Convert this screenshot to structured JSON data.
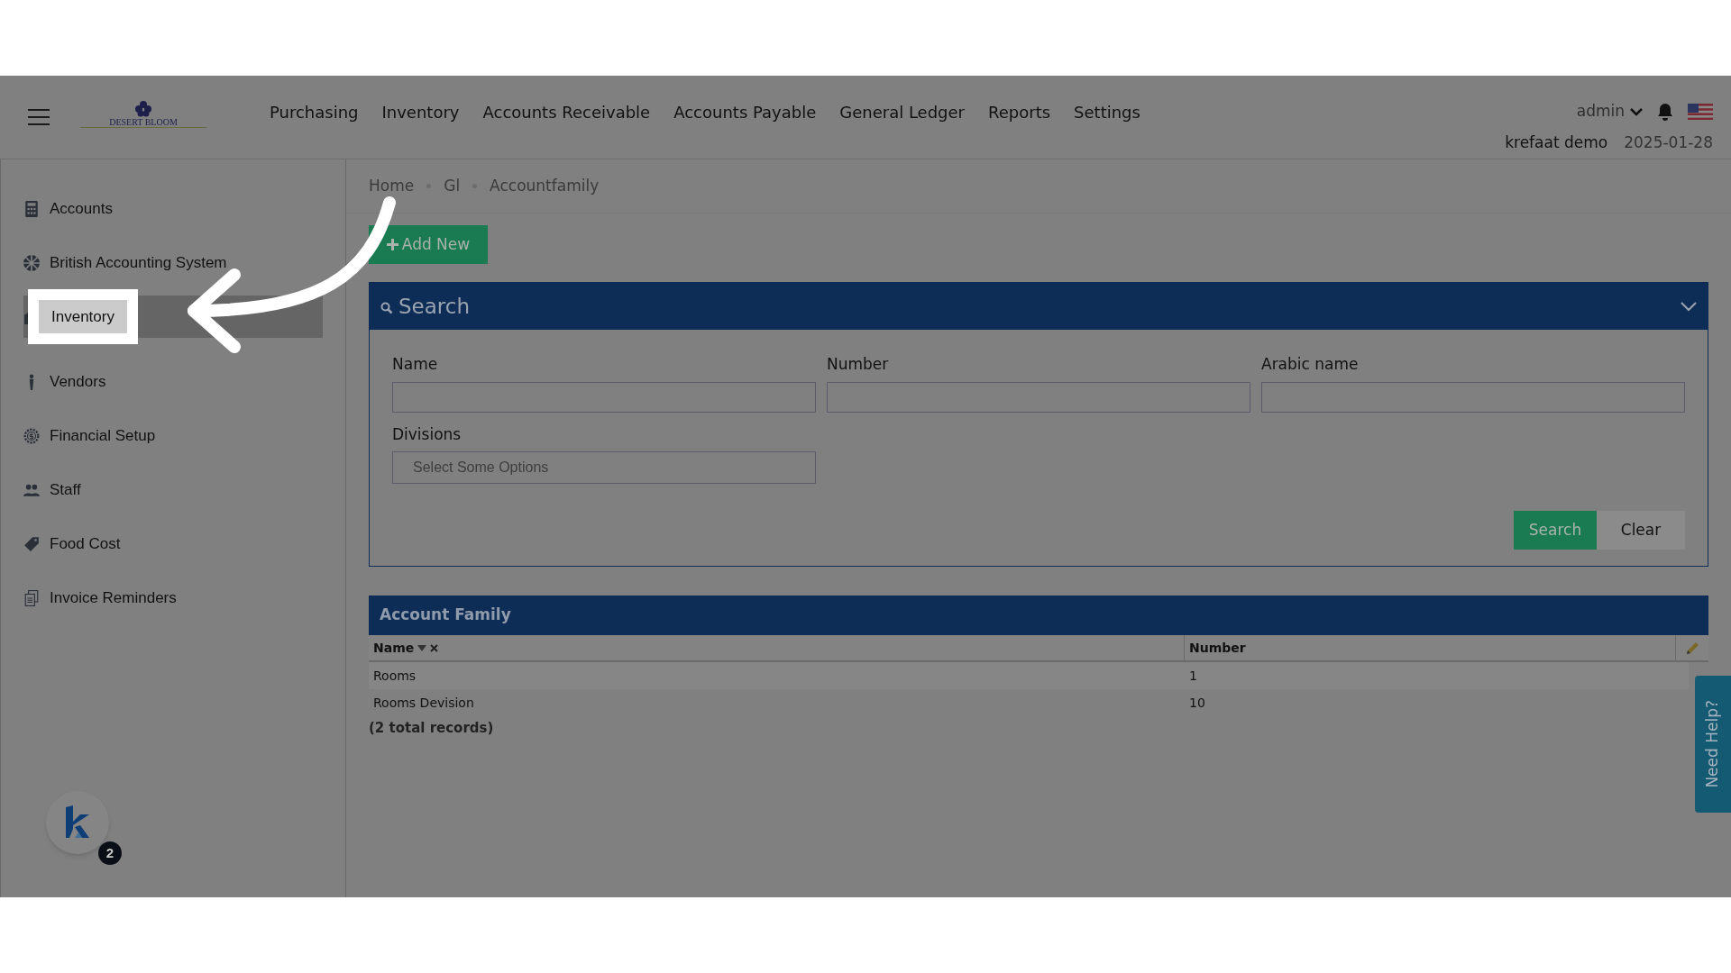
{
  "header": {
    "logo_text": "DESERT BLOOM",
    "menu": [
      "Purchasing",
      "Inventory",
      "Accounts Receivable",
      "Accounts Payable",
      "General Ledger",
      "Reports",
      "Settings"
    ],
    "user": "admin",
    "company": "krefaat demo",
    "date": "2025-01-28"
  },
  "sidebar": {
    "items": [
      {
        "label": "Accounts",
        "selected": false
      },
      {
        "label": "British Accounting System",
        "selected": false
      },
      {
        "label": "Inventory",
        "selected": true
      },
      {
        "label": "Vendors",
        "selected": false
      },
      {
        "label": "Financial Setup",
        "selected": false
      },
      {
        "label": "Staff",
        "selected": false
      },
      {
        "label": "Food Cost",
        "selected": false
      },
      {
        "label": "Invoice Reminders",
        "selected": false
      }
    ],
    "badge": "2"
  },
  "breadcrumb": [
    "Home",
    "Gl",
    "Accountfamily"
  ],
  "add_button": "Add New",
  "search_panel": {
    "title": "Search",
    "fields": [
      {
        "label": "Name",
        "kind": "text"
      },
      {
        "label": "Number",
        "kind": "text"
      },
      {
        "label": "Arabic name",
        "kind": "text"
      },
      {
        "label": "Divisions",
        "kind": "select",
        "placeholder": "Select Some Options"
      }
    ],
    "buttons": [
      "Search",
      "Clear"
    ]
  },
  "table": {
    "title": "Account Family",
    "columns": [
      "Name",
      "Number"
    ],
    "rows": [
      [
        "Rooms",
        "1"
      ],
      [
        "Rooms Devision",
        "10"
      ]
    ],
    "total": "(2 total records)"
  },
  "help_tab": "Need Help?"
}
